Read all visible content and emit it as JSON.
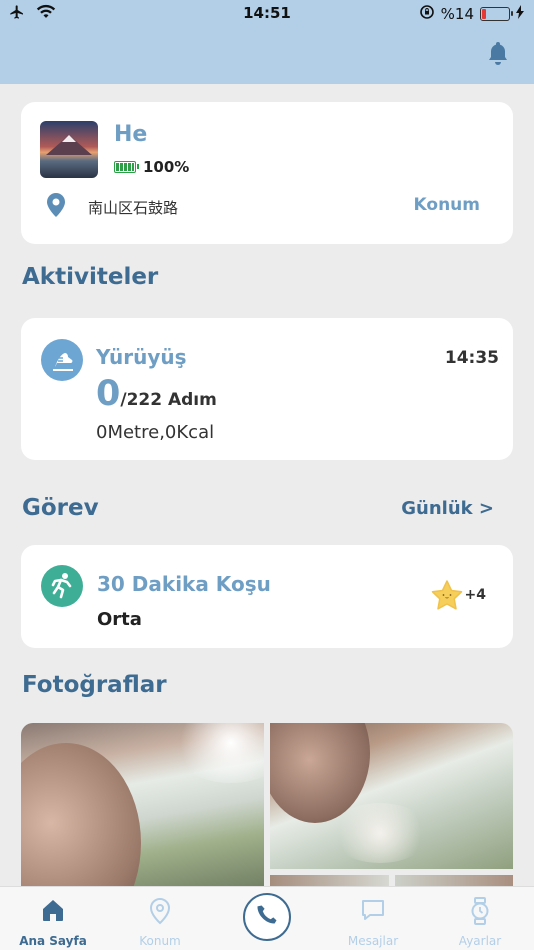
{
  "status_bar": {
    "time": "14:51",
    "battery_text": "%14",
    "battery_level": 0.14
  },
  "device": {
    "name": "He",
    "battery": "100%",
    "address": "南山区石鼓路",
    "location_link": "Konum"
  },
  "activities": {
    "title": "Aktiviteler",
    "item": {
      "title": "Yürüyüş",
      "time": "14:35",
      "steps": "0",
      "steps_goal": "/222 Adım",
      "meta": "0Metre,0Kcal"
    }
  },
  "tasks": {
    "title": "Görev",
    "daily_link": "Günlük >",
    "item": {
      "title": "30 Dakika Koşu",
      "level": "Orta",
      "reward": "+4"
    }
  },
  "photos": {
    "title": "Fotoğraflar"
  },
  "tabbar": {
    "home": "Ana Sayfa",
    "location": "Konum",
    "messages": "Mesajlar",
    "settings": "Ayarlar"
  },
  "colors": {
    "primary": "#3e6b91",
    "accent": "#6f9ec4",
    "header": "#b3cfe8",
    "task_icon": "#3fae96"
  }
}
